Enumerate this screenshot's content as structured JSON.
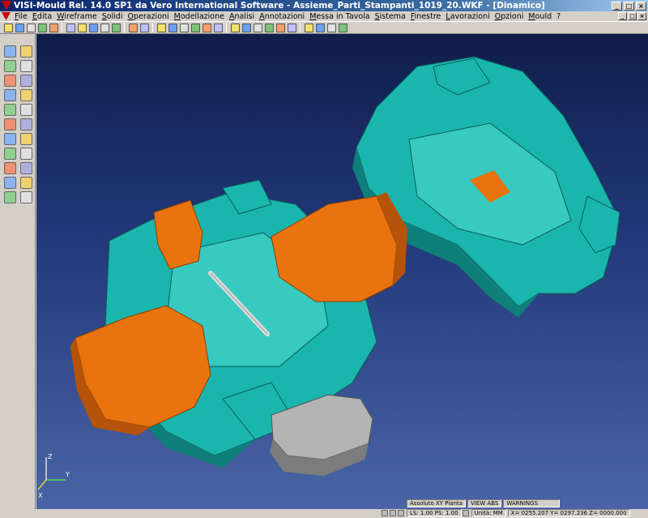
{
  "window": {
    "title": "VISI-Mould Rel. 14.0 SP1 da Vero International Software - Assieme_Parti_Stampanti_1019_20.WKF - [Dinamico]",
    "controls": [
      "_",
      "□",
      "×"
    ]
  },
  "menu": {
    "items": [
      "File",
      "Edita",
      "Wireframe",
      "Solidi",
      "Operazioni",
      "Modellazione",
      "Analisi",
      "Annotazioni",
      "Messa in Tavola",
      "Sistema",
      "Finestre",
      "Lavorazioni",
      "Opzioni",
      "Mould",
      "?"
    ]
  },
  "toolbar": {
    "icons": [
      "new-icon",
      "open-icon",
      "folder-icon",
      "save-icon",
      "print-icon",
      "copy-icon",
      "cut-icon",
      "paste-icon",
      "properties-icon",
      "export-icon",
      "undo-icon",
      "redo-icon",
      "zoom-window-icon",
      "zoom-in-icon",
      "zoom-out-icon",
      "pan-icon",
      "zoom-all-icon",
      "rotate-icon",
      "view-front-icon",
      "view-top-icon",
      "view-side-icon",
      "view-iso-icon",
      "view-back-icon",
      "view-bottom-icon",
      "shaded-icon",
      "wireframe-icon",
      "hidden-line-icon",
      "render-icon"
    ]
  },
  "side_toolbar": {
    "icons": [
      "select-icon",
      "delete-icon",
      "point-icon",
      "line-icon",
      "circle-icon",
      "arc-icon",
      "rectangle-icon",
      "spline-icon",
      "measure-icon",
      "dimension-icon",
      "layer-icon",
      "attribute-icon",
      "transform-icon",
      "mirror-icon",
      "question-icon",
      "solid-icon",
      "trim-icon",
      "extend-icon",
      "filter-icon",
      "group-icon",
      "arrow-left-icon",
      "arrow-right-icon"
    ]
  },
  "axes": {
    "x": "X",
    "y": "Y",
    "z": "Z"
  },
  "colors": {
    "mould_plate": "#1ab6ad",
    "slides": "#e8730f",
    "insert": "#b4b4b4",
    "background_top": "#0f1d4a",
    "background_bottom": "#4a65a6"
  },
  "status": {
    "view_label": "Assoluto XY Pianta",
    "view_mode": "VIEW ABS",
    "warnings": "WARNINGS",
    "scale": "LS: 1.00 PS: 1.00",
    "units": "Unità: MM",
    "coords": "X= 0255.207 Y= 0297.236 Z= 0000.000"
  }
}
